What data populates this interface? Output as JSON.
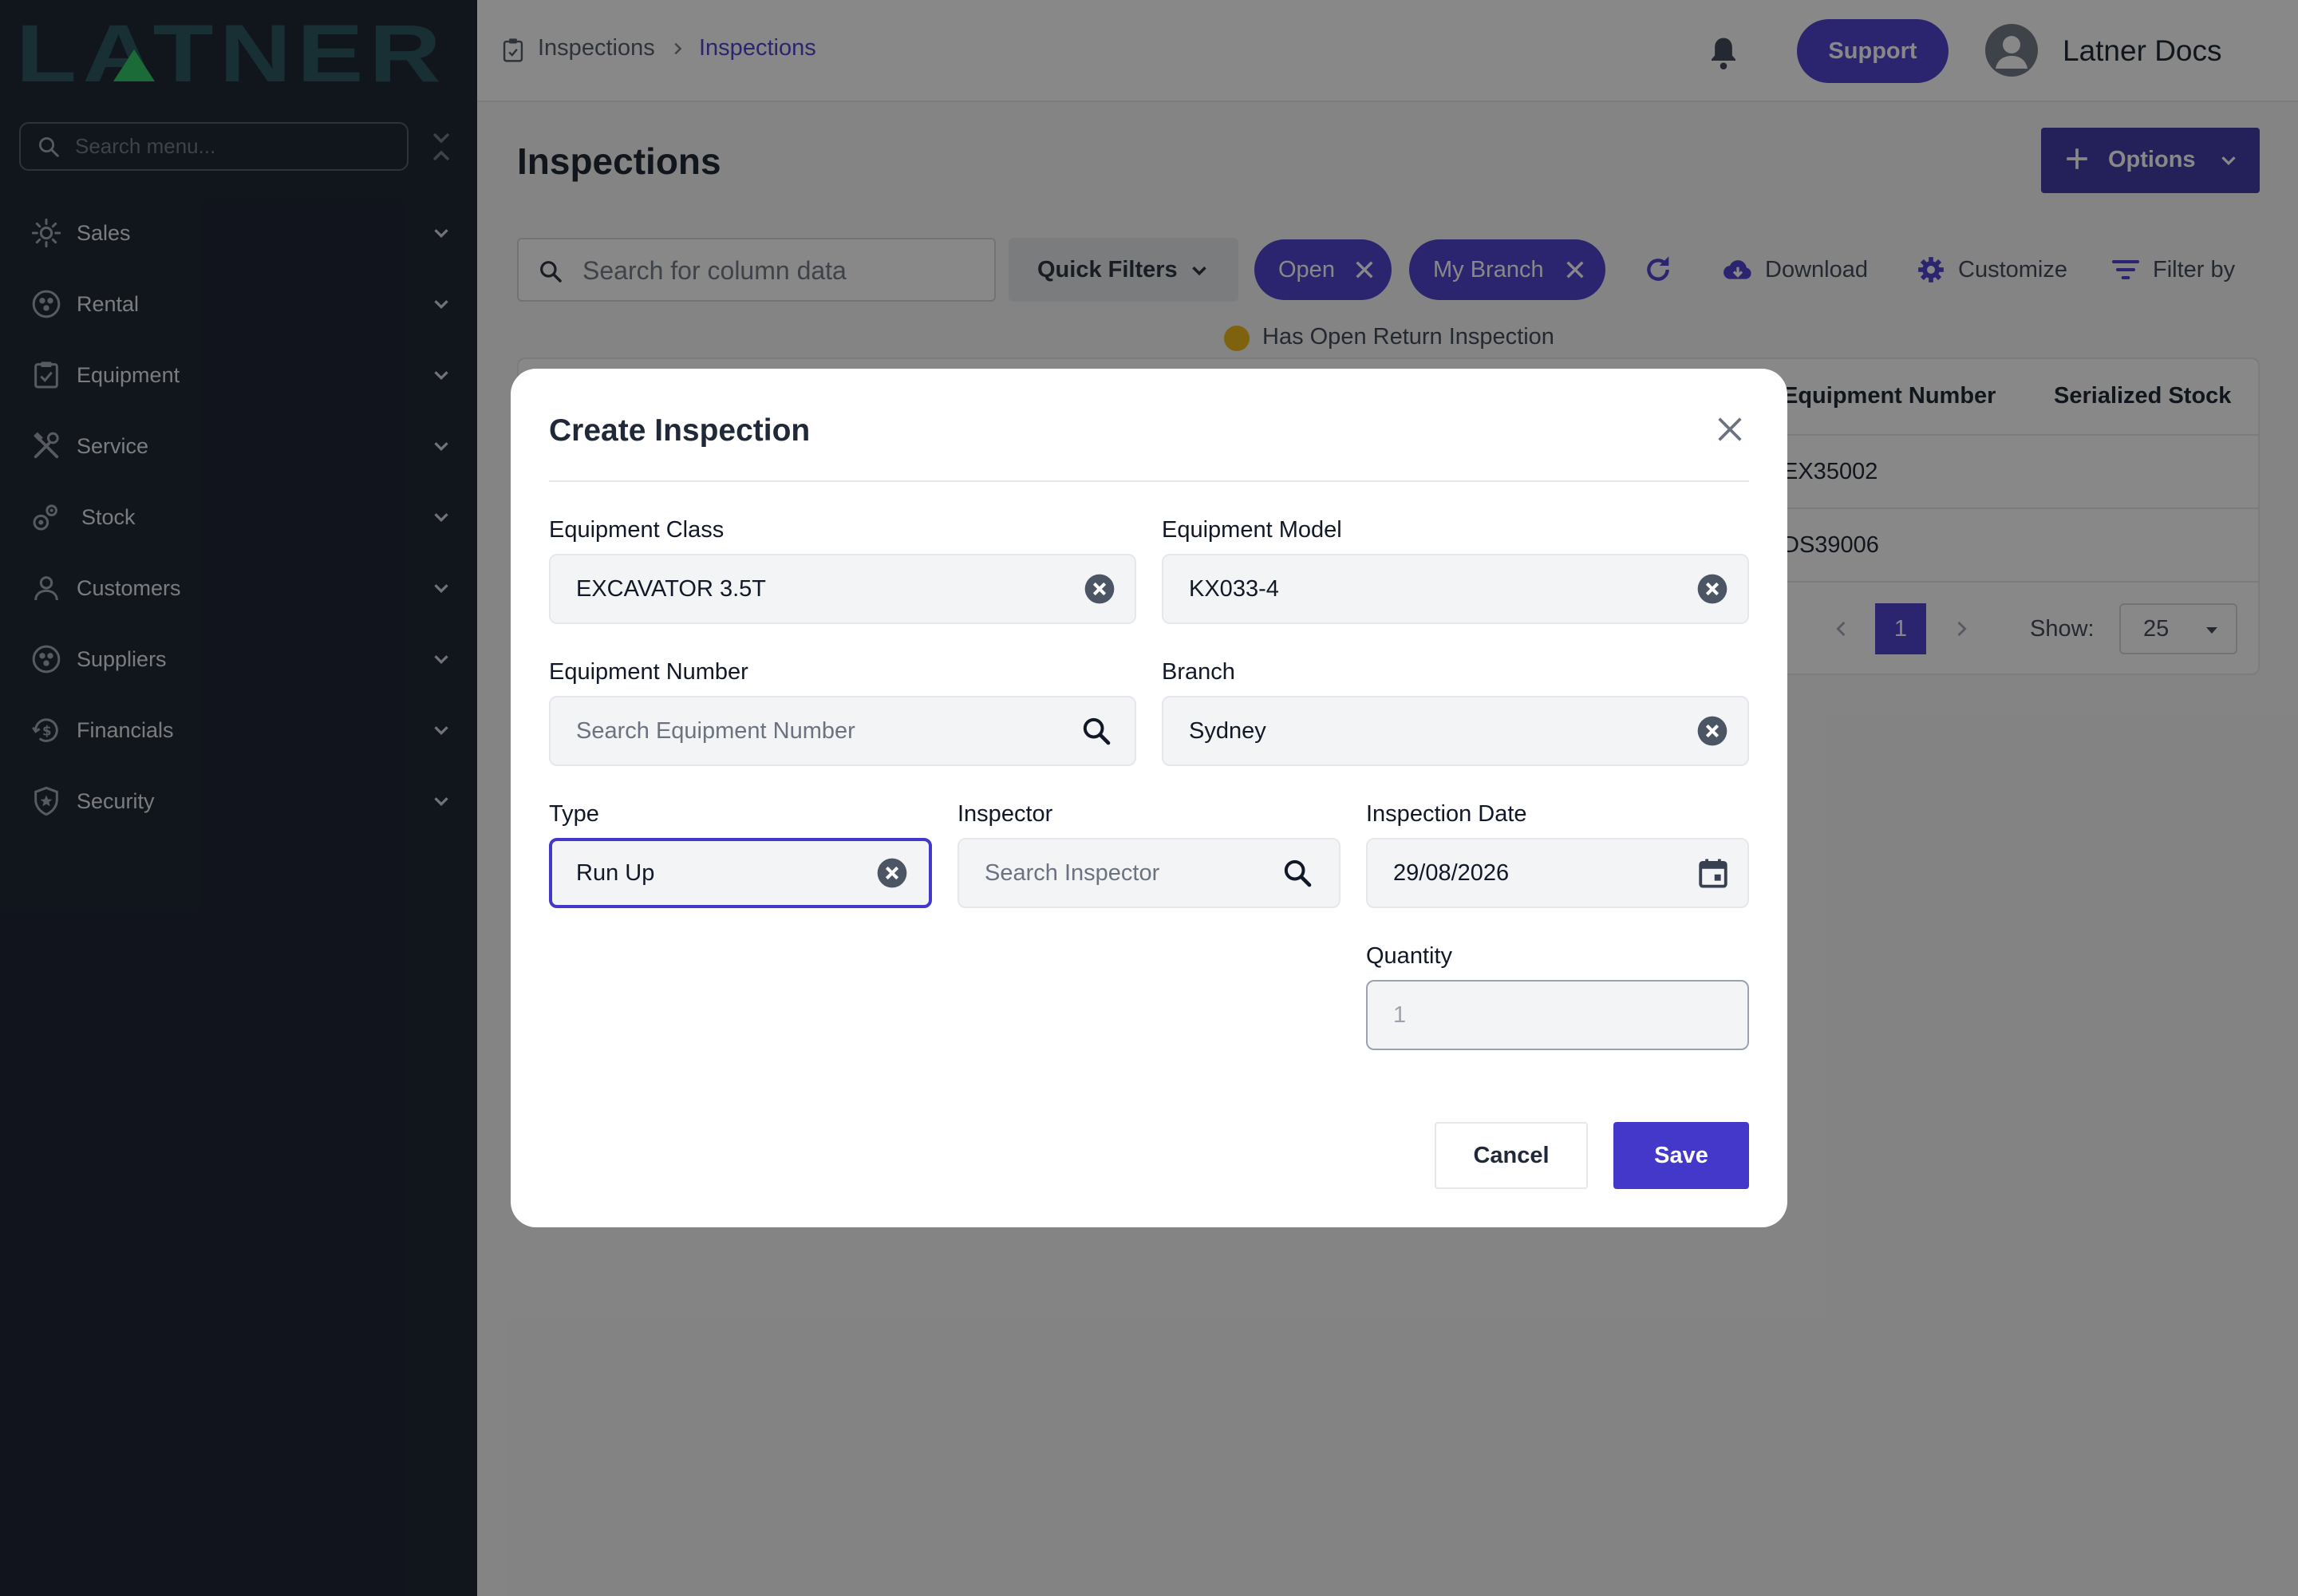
{
  "app": {
    "logo_text": "LATNER"
  },
  "sidebar": {
    "search_placeholder": "Search menu...",
    "items": [
      {
        "label": "Sales",
        "icon": "sales-icon"
      },
      {
        "label": "Rental",
        "icon": "rental-icon"
      },
      {
        "label": "Equipment",
        "icon": "equipment-icon"
      },
      {
        "label": "Service",
        "icon": "service-icon"
      },
      {
        "label": "Stock",
        "icon": "stock-icon"
      },
      {
        "label": "Customers",
        "icon": "customers-icon"
      },
      {
        "label": "Suppliers",
        "icon": "suppliers-icon"
      },
      {
        "label": "Financials",
        "icon": "financials-icon"
      },
      {
        "label": "Security",
        "icon": "security-icon"
      }
    ]
  },
  "header": {
    "breadcrumb": [
      "Inspections",
      "Inspections"
    ],
    "support_label": "Support",
    "user_name": "Latner Docs"
  },
  "main": {
    "title": "Inspections",
    "options_label": "Options",
    "search_placeholder": "Search for column data",
    "quick_filters_label": "Quick Filters",
    "chips": [
      "Open",
      "My Branch"
    ],
    "tools": {
      "download": "Download",
      "customize": "Customize",
      "filter_by": "Filter by"
    },
    "legend": "Has Open Return Inspection",
    "table": {
      "columns": [
        "Equipment Number",
        "Serialized Stock"
      ],
      "rows": [
        [
          "EX35002",
          ""
        ],
        [
          "DS39006",
          ""
        ]
      ]
    },
    "pagination": {
      "current_page": "1",
      "show_label": "Show:",
      "page_size": "25"
    }
  },
  "modal": {
    "title": "Create Inspection",
    "fields": {
      "equipment_class": {
        "label": "Equipment Class",
        "value": "EXCAVATOR 3.5T"
      },
      "equipment_model": {
        "label": "Equipment Model",
        "value": "KX033-4"
      },
      "equipment_number": {
        "label": "Equipment Number",
        "placeholder": "Search Equipment Number"
      },
      "branch": {
        "label": "Branch",
        "value": "Sydney"
      },
      "type": {
        "label": "Type",
        "value": "Run Up"
      },
      "inspector": {
        "label": "Inspector",
        "placeholder": "Search Inspector"
      },
      "inspection_date": {
        "label": "Inspection Date",
        "value": "29/08/2026"
      },
      "quantity": {
        "label": "Quantity",
        "value": "1"
      }
    },
    "cancel_label": "Cancel",
    "save_label": "Save"
  },
  "colors": {
    "sidebar_bg": "#111827",
    "accent": "#4338ca",
    "logo_teal": "#1f4d57",
    "logo_green": "#22c55e",
    "legend_yellow": "#eab308"
  }
}
